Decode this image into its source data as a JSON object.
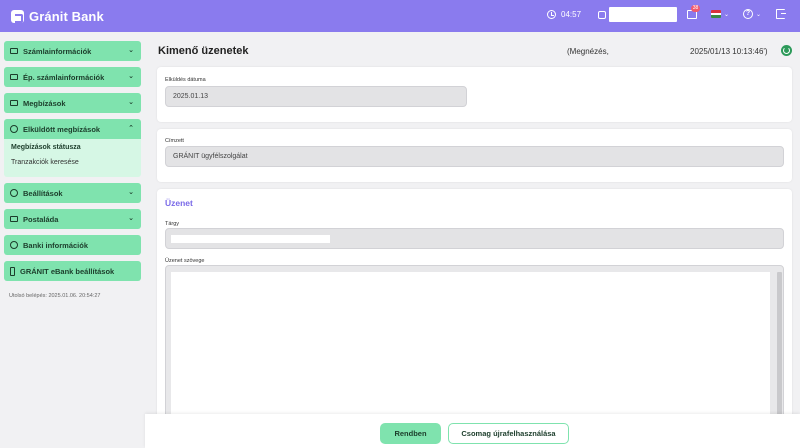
{
  "app": {
    "name": "Gránit Bank"
  },
  "header": {
    "time": "04:57",
    "mail_badge": "38",
    "help_icon": "question-icon",
    "flag_colors": [
      "#d9323c",
      "#ffffff",
      "#3a8a45"
    ]
  },
  "sidebar": {
    "items": [
      {
        "label": "Számlainformációk",
        "icon": "card-icon"
      },
      {
        "label": "Ép. számlainformációk",
        "icon": "card-icon"
      },
      {
        "label": "Megbízások",
        "icon": "card-icon"
      },
      {
        "label": "Elküldött megbízások",
        "icon": "check-circle-icon"
      },
      {
        "label": "Beállítások",
        "icon": "gear-icon"
      },
      {
        "label": "Postaláda",
        "icon": "mail-icon"
      },
      {
        "label": "Banki információk",
        "icon": "info-icon"
      },
      {
        "label": "GRÁNIT eBank beállítások",
        "icon": "phone-icon"
      }
    ],
    "submenu": {
      "active": "Megbízások státusza",
      "item": "Tranzakciók keresése"
    },
    "last_login": "Utolsó belépés: 2025.01.06. 20:54:27"
  },
  "main": {
    "title": "Kimenő üzenetek",
    "query_label": "(Megnézés,",
    "query_date": "2025/01/13 10:13:46')",
    "send_date": {
      "label": "Elküldés dátuma",
      "value": "2025.01.13"
    },
    "recipient": {
      "label": "Címzett",
      "value": "GRÁNIT ügyfélszolgálat"
    },
    "message": {
      "section_title": "Üzenet",
      "subject_label": "Tárgy",
      "body_label": "Üzenet szövege"
    }
  },
  "footer": {
    "ok_label": "Rendben",
    "reuse_label": "Csomag újrafelhasználása"
  },
  "colors": {
    "header": "#8a7bee",
    "accent_green": "#7fe3ae",
    "section_purple": "#7a6ae8"
  }
}
